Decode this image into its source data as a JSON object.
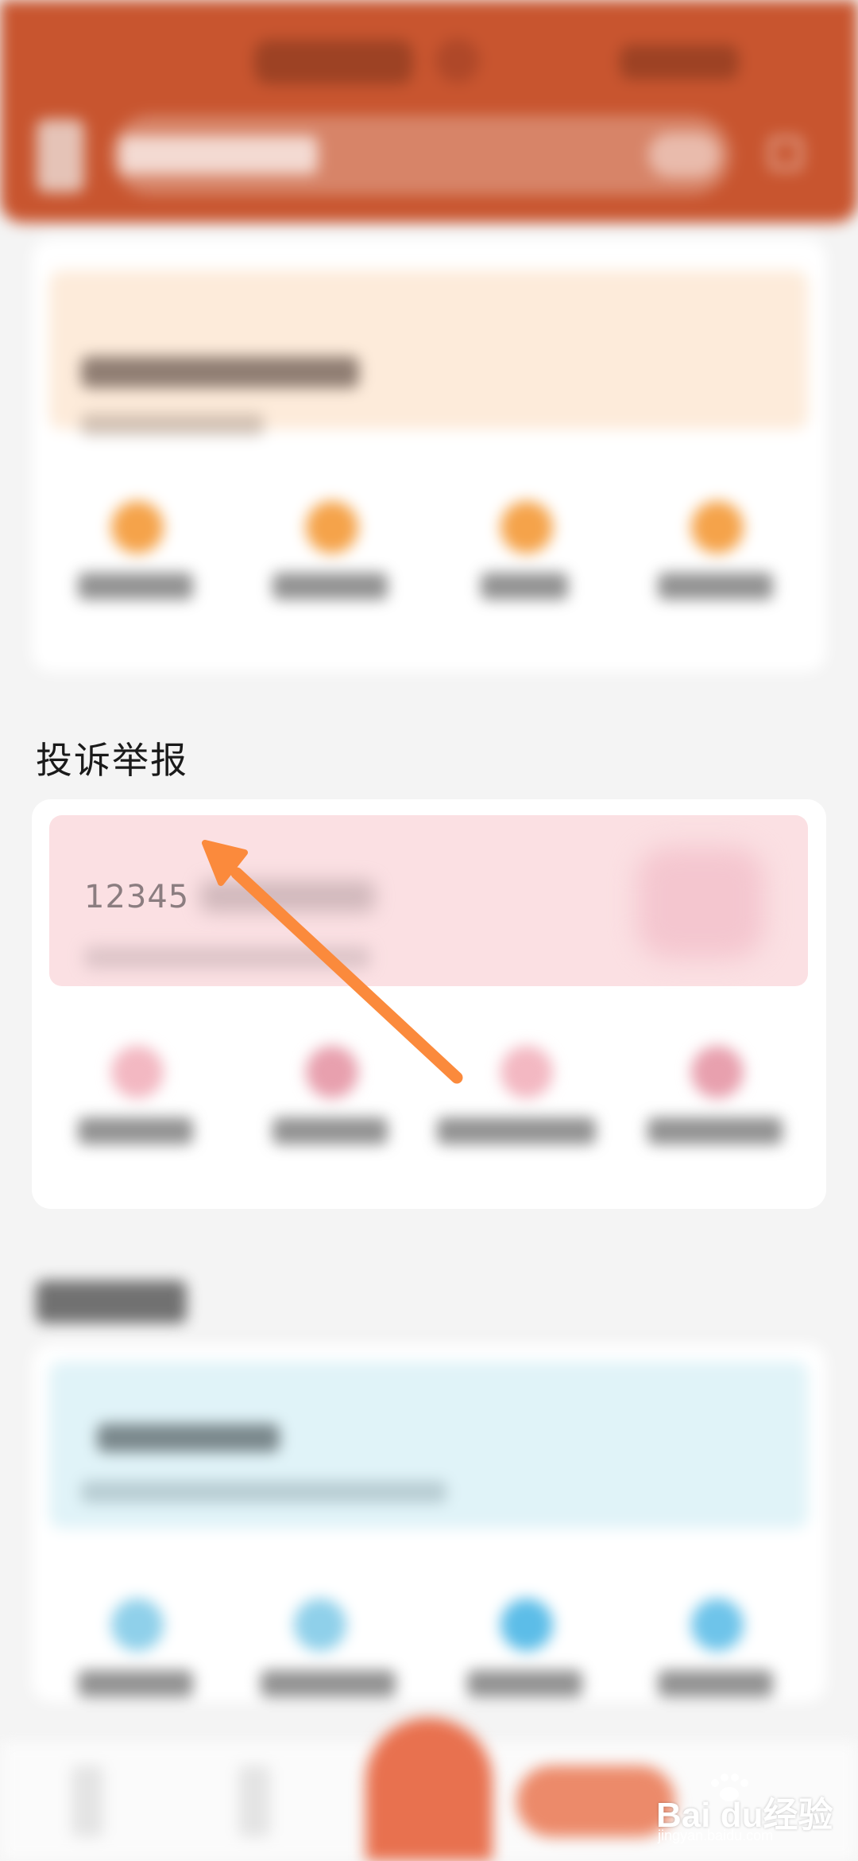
{
  "section": {
    "title": "投诉举报"
  },
  "complaint_banner": {
    "hotline_text": "12345"
  },
  "watermark": {
    "brand": "Bai du经验",
    "url": "jingyan.baidu.com"
  },
  "colors": {
    "header": "#c8552f",
    "annotation_arrow": "#fb8a3c",
    "banner_orange": "#fdebda",
    "banner_pink": "#fbe0e3",
    "banner_blue": "#e0f3f8"
  },
  "icons": [
    "search-icon",
    "menu-icon",
    "arrow-icon",
    "paw-icon"
  ]
}
